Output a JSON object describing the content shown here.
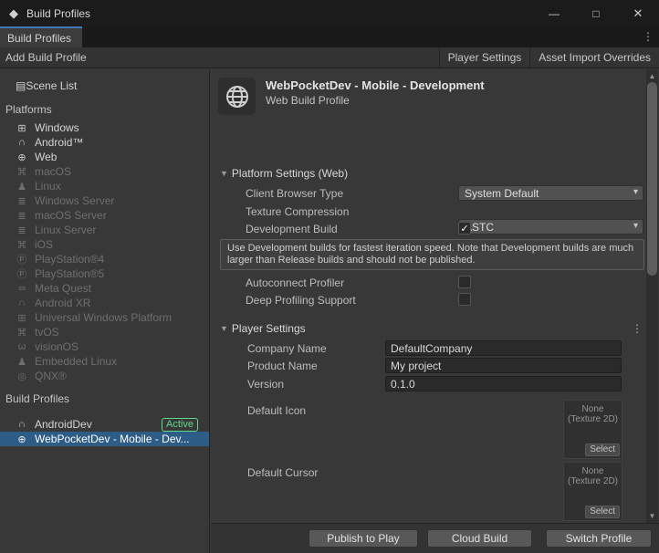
{
  "window": {
    "title": "Build Profiles",
    "controls": {
      "minimize": "—",
      "maximize": "□",
      "close": "✕"
    }
  },
  "tab": {
    "label": "Build Profiles",
    "kebab": "⋮"
  },
  "toolbar": {
    "add_build_profile": "Add Build Profile",
    "player_settings": "Player Settings",
    "asset_import_overrides": "Asset Import Overrides"
  },
  "sidebar": {
    "scene_list": {
      "label": "Scene List",
      "icon": "scene-list"
    },
    "platforms_header": "Platforms",
    "platforms": [
      {
        "label": "Windows",
        "icon": "windows"
      },
      {
        "label": "Android™",
        "icon": "android"
      },
      {
        "label": "Web",
        "icon": "web"
      },
      {
        "label": "macOS",
        "icon": "apple"
      },
      {
        "label": "Linux",
        "icon": "linux"
      },
      {
        "label": "Windows Server",
        "icon": "server"
      },
      {
        "label": "macOS Server",
        "icon": "server"
      },
      {
        "label": "Linux Server",
        "icon": "server"
      },
      {
        "label": "iOS",
        "icon": "apple"
      },
      {
        "label": "PlayStation®4",
        "icon": "playstation"
      },
      {
        "label": "PlayStation®5",
        "icon": "playstation"
      },
      {
        "label": "Meta Quest",
        "icon": "meta"
      },
      {
        "label": "Android XR",
        "icon": "android"
      },
      {
        "label": "Universal Windows Platform",
        "icon": "windows"
      },
      {
        "label": "tvOS",
        "icon": "apple"
      },
      {
        "label": "visionOS",
        "icon": "goggles"
      },
      {
        "label": "Embedded Linux",
        "icon": "linux"
      },
      {
        "label": "QNX®",
        "icon": "qnx"
      }
    ],
    "profiles_header": "Build Profiles",
    "profiles": [
      {
        "label": "AndroidDev",
        "icon": "android",
        "badge": "Active"
      },
      {
        "label": "WebPocketDev - Mobile - Dev...",
        "icon": "web"
      }
    ]
  },
  "main": {
    "header": {
      "title": "WebPocketDev - Mobile - Development",
      "subtitle": "Web Build Profile",
      "icon": "globe"
    },
    "platform_settings": {
      "title": "Platform Settings (Web)",
      "client_browser_type_label": "Client Browser Type",
      "client_browser_type_value": "System Default",
      "texture_compression_label": "Texture Compression",
      "texture_compression_value": "ASTC",
      "development_build_label": "Development Build",
      "development_build_checked": "✓",
      "help_text": "Use Development builds for fastest iteration speed. Note that Development builds are much larger than Release builds and should not be published.",
      "autoconnect_profiler_label": "Autoconnect Profiler",
      "deep_profiling_label": "Deep Profiling Support"
    },
    "player_settings": {
      "title": "Player Settings",
      "kebab": "⋮",
      "company_name_label": "Company Name",
      "company_name_value": "DefaultCompany",
      "product_name_label": "Product Name",
      "product_name_value": "My project",
      "version_label": "Version",
      "version_value": "0.1.0",
      "default_icon_label": "Default Icon",
      "default_cursor_label": "Default Cursor",
      "texture_none_line1": "None",
      "texture_none_line2": "(Texture 2D)",
      "texture_select": "Select"
    },
    "footer": {
      "publish": "Publish to Play",
      "cloud_build": "Cloud Build",
      "switch_profile": "Switch Profile"
    }
  },
  "colors": {
    "selection_blue": "#2d5c87",
    "tab_accent_blue": "#4477b8",
    "active_badge_green": "#61d98b",
    "panel_bg": "#383838",
    "titlebar_bg": "#1b1b1b",
    "field_bg": "#2a2a2a",
    "dropdown_bg": "#515151"
  }
}
